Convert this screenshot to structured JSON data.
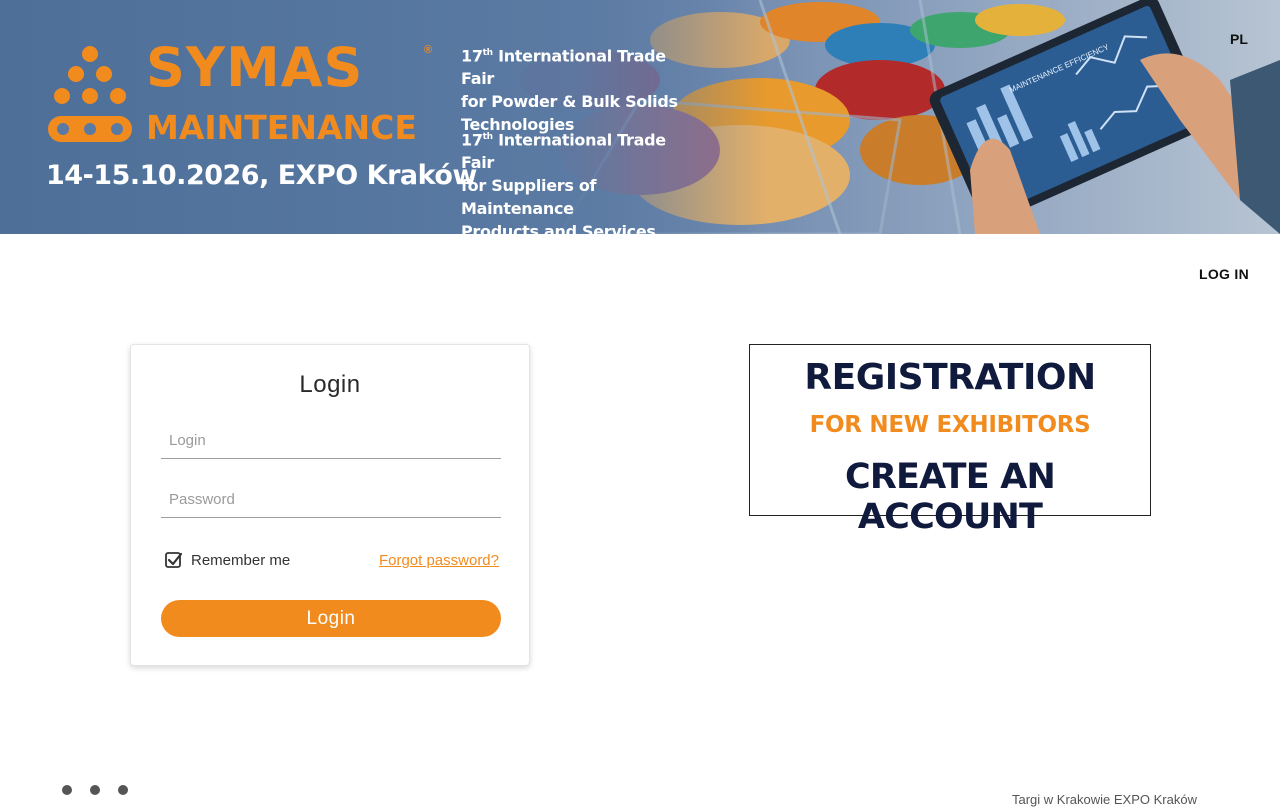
{
  "banner": {
    "logo_name": "SYMAS",
    "logo_registered": "®",
    "logo_subtitle": "MAINTENANCE",
    "event_date": "14-15.10.2026, EXPO Kraków",
    "fair_1": {
      "ordinal_num": "17",
      "ordinal_suffix": "th",
      "line1_rest": " International Trade Fair",
      "line2": "for Powder & Bulk Solids",
      "line3": "Technologies"
    },
    "fair_2": {
      "ordinal_num": "17",
      "ordinal_suffix": "th",
      "line1_rest": " International Trade Fair",
      "line2": "for Suppliers of Maintenance",
      "line3": "Products and Services"
    },
    "tablet_title": "MAINTENANCE EFFICIENCY",
    "language_link": "PL"
  },
  "nav": {
    "login_link": "LOG IN"
  },
  "login_card": {
    "title": "Login",
    "login_placeholder": "Login",
    "password_placeholder": "Password",
    "remember_label": "Remember me",
    "remember_checked": true,
    "forgot_link": "Forgot password?",
    "submit_label": "Login"
  },
  "registration": {
    "title": "REGISTRATION",
    "subtitle": "FOR NEW EXHIBITORS",
    "cta": "CREATE AN ACCOUNT"
  },
  "footer": {
    "text": "Targi w Krakowie EXPO Kraków"
  },
  "colors": {
    "accent": "#f28b1e",
    "navy": "#0f1a3d"
  }
}
